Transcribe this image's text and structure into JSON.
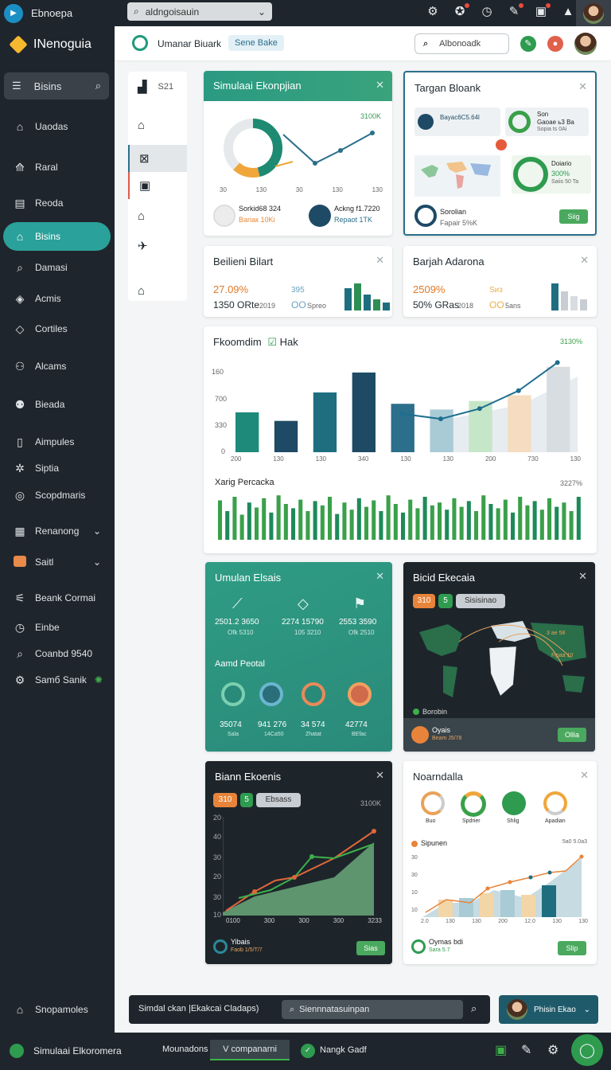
{
  "topbar": {
    "app_title": "Ebnoepa",
    "search_text": "aldngoisauin",
    "icons": [
      "gear-icon",
      "settings-icon",
      "clock-icon",
      "edit-icon",
      "image-icon",
      "alert-icon"
    ]
  },
  "sidebar": {
    "brand": "INenoguia",
    "search_label": "Bisins",
    "items": [
      {
        "label": "Uaodas",
        "icon": "home-icon"
      },
      {
        "label": "Raral",
        "icon": "chart-icon"
      },
      {
        "label": "Reoda",
        "icon": "doc-icon"
      },
      {
        "label": "Bisins",
        "icon": "building-icon",
        "active": true
      },
      {
        "label": "Damasi",
        "icon": "search-icon"
      },
      {
        "label": "Acmis",
        "icon": "tag-icon"
      },
      {
        "label": "Cortiles",
        "icon": "diamond-icon"
      },
      {
        "label": "Alcams",
        "icon": "users-icon"
      },
      {
        "label": "Bieada",
        "icon": "group-icon"
      },
      {
        "label": "Aimpules",
        "icon": "doc-icon"
      },
      {
        "label": "Siptia",
        "icon": "network-icon"
      },
      {
        "label": "Scopdmaris",
        "icon": "target-icon"
      },
      {
        "label": "Renanong",
        "icon": "grid-icon",
        "chevron": true
      },
      {
        "label": "Saitl",
        "icon": "badge-icon",
        "chevron": true
      },
      {
        "label": "Beank Cormai",
        "icon": "settings-icon"
      },
      {
        "label": "Einbe",
        "icon": "clock-icon"
      },
      {
        "label": "Coanbd 9540",
        "icon": "search-icon"
      },
      {
        "label": "Samб Sanik",
        "icon": "gear-icon"
      }
    ],
    "footer_label": "Snopamoles"
  },
  "header": {
    "title": "Umanar Biuark",
    "tag": "Sene Bake",
    "search_placeholder": "Albonoadk"
  },
  "rail": {
    "label": "S21"
  },
  "cards": {
    "sim": {
      "title": "Simulaai Ekonpjian",
      "corner": "3100K",
      "axis": [
        "30",
        "130",
        "30",
        "130",
        "130"
      ],
      "legend1": "Sorkid​6​8 324",
      "legend1_sub": "Bariaк 1​0Ki",
      "legend2": "Ackng f​1.7220",
      "legend2_sub": "Repaot 1T​​​​K"
    },
    "targ": {
      "title": "Targan Bloank",
      "box1": "Bayac6C5.64l",
      "box2_t": "Son",
      "box2_a": "Gaoae ь3 Ba",
      "box2_b": "Sopia ts 0Ai",
      "box3_t": "Doiario",
      "box3_v": "300%",
      "box3_s": "Saiis 50 Ta",
      "foot_t": "Sorolian",
      "foot_s": "Fapair 5%K",
      "btn": "Siig"
    },
    "bel": {
      "title": "Beilieni Bilart",
      "v1": "27.09%",
      "v2": "1350 ORte",
      "v2s": "2019",
      "v3": "395",
      "v4": "OO",
      "v4s": "Spreo"
    },
    "bar": {
      "title": "Barjah Adarona",
      "v1": "2509%",
      "v2": "50% GRas",
      "v2s": "2018",
      "v3": "Sиз",
      "v4": "OO",
      "v4s": "5ans"
    },
    "ekon": {
      "title": "Fkoomdim",
      "check": "Hak",
      "corner": "3​1​3​0​%",
      "yticks": [
        "160",
        "700",
        "330",
        "0"
      ],
      "xticks": [
        "200",
        "130",
        "130",
        "340",
        "130",
        "130",
        "200",
        "730",
        "130"
      ],
      "sub": "Xarig Percacka",
      "sub_corner": "3227​%"
    },
    "umul": {
      "title": "Umulan Elsais",
      "s1": "2501.2 3650",
      "s1b": "Ofk 5310",
      "s2": "2274 15790",
      "s2b": "105 3210",
      "s3": "2553 3590",
      "s3b": "Ofk 2510",
      "sub": "Aamd Peotal",
      "r1": "35074",
      "r1b": "Sala",
      "r2": "941 276",
      "r2b": "14Ca50",
      "r3": "34 574",
      "r3b": "Zhatat",
      "r4": "42774",
      "r4b": "BEfac"
    },
    "bicid": {
      "title": "Bicid Ekecaia",
      "p1": "310",
      "p2": "5",
      "p3": "Sisisinao",
      "legend": "Borobin",
      "m1": "3 ae 5​8",
      "m2": "Fipaa 1​​0",
      "foot_t": "Oyais",
      "foot_s": "Beam J5/78",
      "btn": "Ollia"
    },
    "bian": {
      "title": "Biann Ekoenis",
      "p1": "310",
      "p2": "5",
      "p3": "Ebsass",
      "corner": "3100K",
      "yticks": [
        "20",
        "40",
        "30",
        "20",
        "30",
        "10"
      ],
      "xticks": [
        "0100",
        "300",
        "300",
        "300",
        "3233"
      ],
      "foot_t": "Yibais",
      "foot_s": "Faob 1/5/T/7",
      "btn": "Sias"
    },
    "noan": {
      "title": "Noarndalla",
      "labels": [
        "Buo",
        "Spdrier",
        "Shlig",
        "Apadian"
      ],
      "sub": "Sipunen",
      "corner": "5a0 5.0a3",
      "yticks": [
        "30",
        "30",
        "10",
        "10"
      ],
      "xticks": [
        "2.0",
        "130",
        "130",
        "200",
        "12.0",
        "130",
        "130"
      ],
      "foot_t": "Oymas bdi",
      "foot_s": "Sara 5.7​​​​",
      "btn": "Slip"
    }
  },
  "footer": {
    "left": "Simdal ckan |Ekakcai Cladaps)",
    "search": "Siennnatasuinpan",
    "user": "Phisin Ekao"
  },
  "bottombar": {
    "title": "Simulaai Elkoromera",
    "tab1": "Mounadons",
    "tab2": "V companarni",
    "tab3": "Nangk Gadf"
  },
  "chart_data": [
    {
      "type": "line",
      "title": "Fkoomdim",
      "categories": [
        "200",
        "130",
        "130",
        "340",
        "130",
        "130",
        "200",
        "730",
        "130"
      ],
      "series": [
        {
          "name": "bars",
          "values": [
            28,
            22,
            42,
            56,
            34,
            30,
            36,
            40,
            60
          ]
        },
        {
          "name": "line",
          "values": [
            null,
            null,
            null,
            null,
            30,
            26,
            34,
            48,
            70
          ]
        }
      ],
      "ylim": [
        0,
        160
      ]
    },
    {
      "type": "bar",
      "title": "Xarig Percacka",
      "values": [
        55,
        40,
        60,
        35,
        52,
        45,
        58,
        38,
        62,
        50,
        44,
        56,
        40,
        54,
        48,
        60,
        36,
        52,
        42,
        58,
        46,
        55,
        40,
        62,
        50,
        38,
        56,
        44,
        60,
        48,
        52,
        42,
        58,
        46,
        54,
        40,
        62,
        50,
        44,
        56,
        38,
        60,
        48,
        54,
        42,
        58,
        46,
        52,
        40,
        60
      ]
    }
  ]
}
